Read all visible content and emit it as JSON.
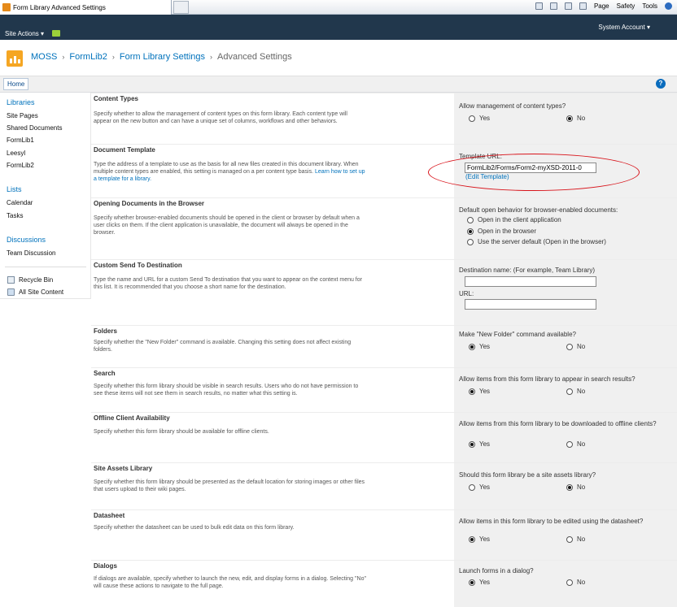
{
  "browser": {
    "tab_title": "Form Library Advanced Settings",
    "commands": [
      "Page",
      "Safety",
      "Tools"
    ]
  },
  "ribbon": {
    "site_actions": "Site Actions",
    "system_account": "System Account"
  },
  "breadcrumb": {
    "items": [
      "MOSS",
      "FormLib2",
      "Form Library Settings"
    ],
    "current": "Advanced Settings",
    "separator": "›"
  },
  "topnav": {
    "home": "Home"
  },
  "quicklaunch": {
    "libraries": {
      "heading": "Libraries",
      "items": [
        "Site Pages",
        "Shared Documents",
        "FormLib1",
        "Leesyl",
        "FormLib2"
      ]
    },
    "lists": {
      "heading": "Lists",
      "items": [
        "Calendar",
        "Tasks"
      ]
    },
    "discussions": {
      "heading": "Discussions",
      "items": [
        "Team Discussion"
      ]
    },
    "recycle_bin": "Recycle Bin",
    "all_site_content": "All Site Content"
  },
  "sections": {
    "content_types": {
      "title": "Content Types",
      "description": "Specify whether to allow the management of content types on this form library. Each content type will appear on the new button and can have a unique set of columns, workflows and other behaviors.",
      "question": "Allow management of content types?",
      "yes": "Yes",
      "no": "No",
      "selected": "no"
    },
    "document_template": {
      "title": "Document Template",
      "description": "Type the address of a template to use as the basis for all new files created in this document library. When multiple content types are enabled, this setting is managed on a per content type basis.",
      "learn_link": "Learn how to set up a template for a library.",
      "label": "Template URL:",
      "url_value": "FormLib2/Forms/Form2-myXSD-2011-0",
      "edit_link": "(Edit Template)"
    },
    "opening_documents": {
      "title": "Opening Documents in the Browser",
      "description": "Specify whether browser-enabled documents should be opened in the client or browser by default when a user clicks on them. If the client application is unavailable, the document will always be opened in the browser.",
      "question": "Default open behavior for browser-enabled documents:",
      "options": [
        "Open in the client application",
        "Open in the browser",
        "Use the server default (Open in the browser)"
      ],
      "selected_index": 1
    },
    "custom_send_to": {
      "title": "Custom Send To Destination",
      "description": "Type the name and URL for a custom Send To destination that you want to appear on the context menu for this list. It is recommended that you choose a short name for the destination.",
      "name_label": "Destination name: (For example, Team Library)",
      "url_label": "URL:",
      "name_value": "",
      "url_value": ""
    },
    "folders": {
      "title": "Folders",
      "description": "Specify whether the \"New Folder\" command is available. Changing this setting does not affect existing folders.",
      "question": "Make \"New Folder\" command available?",
      "yes": "Yes",
      "no": "No",
      "selected": "yes"
    },
    "search": {
      "title": "Search",
      "description": "Specify whether this form library should be visible in search results. Users who do not have permission to see these items will not see them in search results, no matter what this setting is.",
      "question": "Allow items from this form library to appear in search results?",
      "yes": "Yes",
      "no": "No",
      "selected": "yes"
    },
    "offline": {
      "title": "Offline Client Availability",
      "description": "Specify whether this form library should be available for offline clients.",
      "question": "Allow items from this form library to be downloaded to offline clients?",
      "yes": "Yes",
      "no": "No",
      "selected": "yes"
    },
    "site_assets": {
      "title": "Site Assets Library",
      "description": "Specify whether this form library should be presented as the default location for storing images or other files that users upload to their wiki pages.",
      "question": "Should this form library be a site assets library?",
      "yes": "Yes",
      "no": "No",
      "selected": "no"
    },
    "datasheet": {
      "title": "Datasheet",
      "description": "Specify whether the datasheet can be used to bulk edit data on this form library.",
      "question": "Allow items in this form library to be edited using the datasheet?",
      "yes": "Yes",
      "no": "No",
      "selected": "yes"
    },
    "dialogs": {
      "title": "Dialogs",
      "description": "If dialogs are available, specify whether to launch the new, edit, and display forms in a dialog. Selecting \"No\" will cause these actions to navigate to the full page.",
      "question": "Launch forms in a dialog?",
      "yes": "Yes",
      "no": "No",
      "selected": "yes"
    }
  },
  "colors": {
    "ribbon": "#21374c",
    "link": "#0072bc",
    "control_column": "#f0f0f0",
    "highlight_oval": "#d8131a"
  }
}
